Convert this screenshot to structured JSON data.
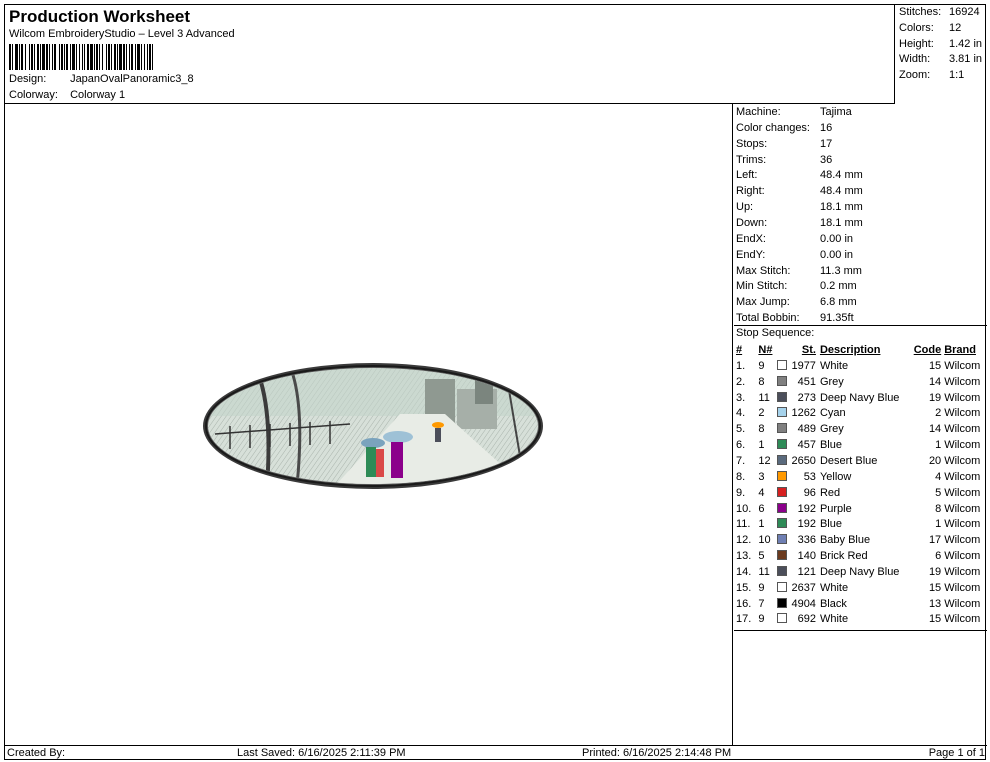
{
  "header": {
    "title": "Production Worksheet",
    "subtitle": "Wilcom EmbroideryStudio – Level 3 Advanced",
    "design_label": "Design:",
    "design_value": "JapanOvalPanoramic3_8",
    "colorway_label": "Colorway:",
    "colorway_value": "Colorway 1"
  },
  "stats": {
    "stitches_label": "Stitches:",
    "stitches_value": "16924",
    "colors_label": "Colors:",
    "colors_value": "12",
    "height_label": "Height:",
    "height_value": "1.42 in",
    "width_label": "Width:",
    "width_value": "3.81 in",
    "zoom_label": "Zoom:",
    "zoom_value": "1:1"
  },
  "properties": [
    {
      "label": "Machine:",
      "value": "Tajima"
    },
    {
      "label": "Color changes:",
      "value": "16"
    },
    {
      "label": "Stops:",
      "value": "17"
    },
    {
      "label": "Trims:",
      "value": "36"
    },
    {
      "label": "Left:",
      "value": "48.4 mm"
    },
    {
      "label": "Right:",
      "value": "48.4 mm"
    },
    {
      "label": "Up:",
      "value": "18.1 mm"
    },
    {
      "label": "Down:",
      "value": "18.1 mm"
    },
    {
      "label": "EndX:",
      "value": "0.00 in"
    },
    {
      "label": "EndY:",
      "value": "0.00 in"
    },
    {
      "label": "Max Stitch:",
      "value": "11.3 mm"
    },
    {
      "label": "Min Stitch:",
      "value": "0.2 mm"
    },
    {
      "label": "Max Jump:",
      "value": "6.8 mm"
    },
    {
      "label": "Total Bobbin:",
      "value": "91.35ft"
    }
  ],
  "stop_sequence": {
    "title": "Stop Sequence:",
    "headers": {
      "idx": "#",
      "needle": "N#",
      "stitches": "St.",
      "description": "Description",
      "code": "Code",
      "brand": "Brand"
    },
    "rows": [
      {
        "idx": "1.",
        "needle": "9",
        "color": "#ffffff",
        "stitches": "1977",
        "description": "White",
        "code": "15",
        "brand": "Wilcom"
      },
      {
        "idx": "2.",
        "needle": "8",
        "color": "#808080",
        "stitches": "451",
        "description": "Grey",
        "code": "14",
        "brand": "Wilcom"
      },
      {
        "idx": "3.",
        "needle": "11",
        "color": "#4b4e5a",
        "stitches": "273",
        "description": "Deep Navy Blue",
        "code": "19",
        "brand": "Wilcom"
      },
      {
        "idx": "4.",
        "needle": "2",
        "color": "#a6d3ec",
        "stitches": "1262",
        "description": "Cyan",
        "code": "2",
        "brand": "Wilcom"
      },
      {
        "idx": "5.",
        "needle": "8",
        "color": "#808080",
        "stitches": "489",
        "description": "Grey",
        "code": "14",
        "brand": "Wilcom"
      },
      {
        "idx": "6.",
        "needle": "1",
        "color": "#2e8b57",
        "stitches": "457",
        "description": "Blue",
        "code": "1",
        "brand": "Wilcom"
      },
      {
        "idx": "7.",
        "needle": "12",
        "color": "#5a6a7d",
        "stitches": "2650",
        "description": "Desert Blue",
        "code": "20",
        "brand": "Wilcom"
      },
      {
        "idx": "8.",
        "needle": "3",
        "color": "#ff9900",
        "stitches": "53",
        "description": "Yellow",
        "code": "4",
        "brand": "Wilcom"
      },
      {
        "idx": "9.",
        "needle": "4",
        "color": "#d62020",
        "stitches": "96",
        "description": "Red",
        "code": "5",
        "brand": "Wilcom"
      },
      {
        "idx": "10.",
        "needle": "6",
        "color": "#8b008b",
        "stitches": "192",
        "description": "Purple",
        "code": "8",
        "brand": "Wilcom"
      },
      {
        "idx": "11.",
        "needle": "1",
        "color": "#2e8b57",
        "stitches": "192",
        "description": "Blue",
        "code": "1",
        "brand": "Wilcom"
      },
      {
        "idx": "12.",
        "needle": "10",
        "color": "#6f7fb3",
        "stitches": "336",
        "description": "Baby Blue",
        "code": "17",
        "brand": "Wilcom"
      },
      {
        "idx": "13.",
        "needle": "5",
        "color": "#6b3a1e",
        "stitches": "140",
        "description": "Brick Red",
        "code": "6",
        "brand": "Wilcom"
      },
      {
        "idx": "14.",
        "needle": "11",
        "color": "#4b4e5a",
        "stitches": "121",
        "description": "Deep Navy Blue",
        "code": "19",
        "brand": "Wilcom"
      },
      {
        "idx": "15.",
        "needle": "9",
        "color": "#ffffff",
        "stitches": "2637",
        "description": "White",
        "code": "15",
        "brand": "Wilcom"
      },
      {
        "idx": "16.",
        "needle": "7",
        "color": "#000000",
        "stitches": "4904",
        "description": "Black",
        "code": "13",
        "brand": "Wilcom"
      },
      {
        "idx": "17.",
        "needle": "9",
        "color": "#ffffff",
        "stitches": "692",
        "description": "White",
        "code": "15",
        "brand": "Wilcom"
      }
    ]
  },
  "footer": {
    "created_by": "Created By:",
    "last_saved": "Last Saved: 6/16/2025 2:11:39 PM",
    "printed": "Printed: 6/16/2025 2:14:48 PM",
    "page": "Page 1 of 1"
  },
  "design_image": {
    "icon": "oval-embroidery-preview",
    "border_color": "#2b2b2b",
    "fill_color": "#c9d3cc"
  }
}
